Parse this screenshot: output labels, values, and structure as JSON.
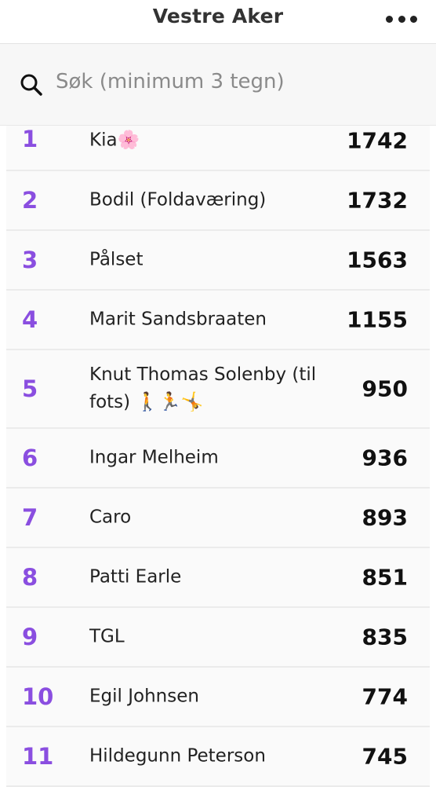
{
  "header": {
    "title": "Vestre Aker",
    "menu_icon": "more-horizontal-icon"
  },
  "search": {
    "icon": "search-icon",
    "placeholder": "Søk (minimum 3 tegn)"
  },
  "leaderboard": [
    {
      "rank": "1",
      "name": "Kia🌸",
      "score": "1742"
    },
    {
      "rank": "2",
      "name": "Bodil (Foldaværing)",
      "score": "1732"
    },
    {
      "rank": "3",
      "name": "Pålset",
      "score": "1563"
    },
    {
      "rank": "4",
      "name": "Marit Sandsbraaten",
      "score": "1155"
    },
    {
      "rank": "5",
      "name": "Knut Thomas Solenby (til fots) 🚶🏃🤸",
      "score": "950"
    },
    {
      "rank": "6",
      "name": "Ingar Melheim",
      "score": "936"
    },
    {
      "rank": "7",
      "name": "Caro",
      "score": "893"
    },
    {
      "rank": "8",
      "name": "Patti Earle",
      "score": "851"
    },
    {
      "rank": "9",
      "name": "TGL",
      "score": "835"
    },
    {
      "rank": "10",
      "name": "Egil Johnsen",
      "score": "774"
    },
    {
      "rank": "11",
      "name": "Hildegunn Peterson",
      "score": "745"
    }
  ],
  "colors": {
    "rank": "#8a4ee0",
    "row_background": "#fafafa",
    "divider": "#ebebeb"
  }
}
